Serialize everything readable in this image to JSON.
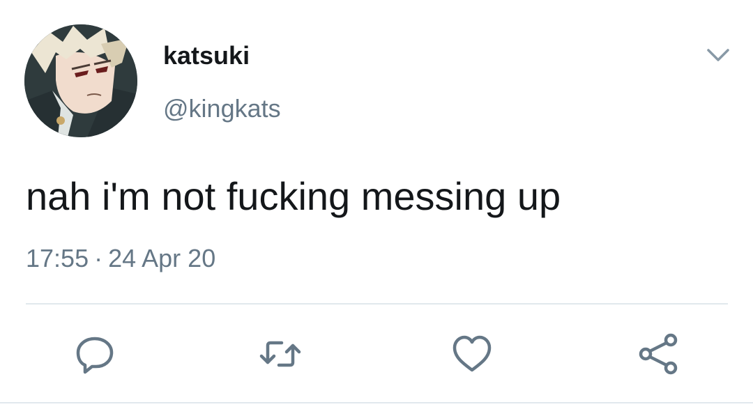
{
  "user": {
    "display_name": "katsuki",
    "handle": "@kingkats",
    "avatar_icon": "profile-avatar"
  },
  "tweet": {
    "text": "nah i'm not fucking messing up",
    "time": "17:55",
    "separator": "·",
    "date": "24 Apr 20"
  },
  "actions": [
    {
      "icon": "reply-icon"
    },
    {
      "icon": "retweet-icon"
    },
    {
      "icon": "like-icon"
    },
    {
      "icon": "share-icon"
    }
  ],
  "colors": {
    "text": "#14171a",
    "secondary": "#657786",
    "icon": "#657786",
    "divider": "#e1e8ed"
  }
}
